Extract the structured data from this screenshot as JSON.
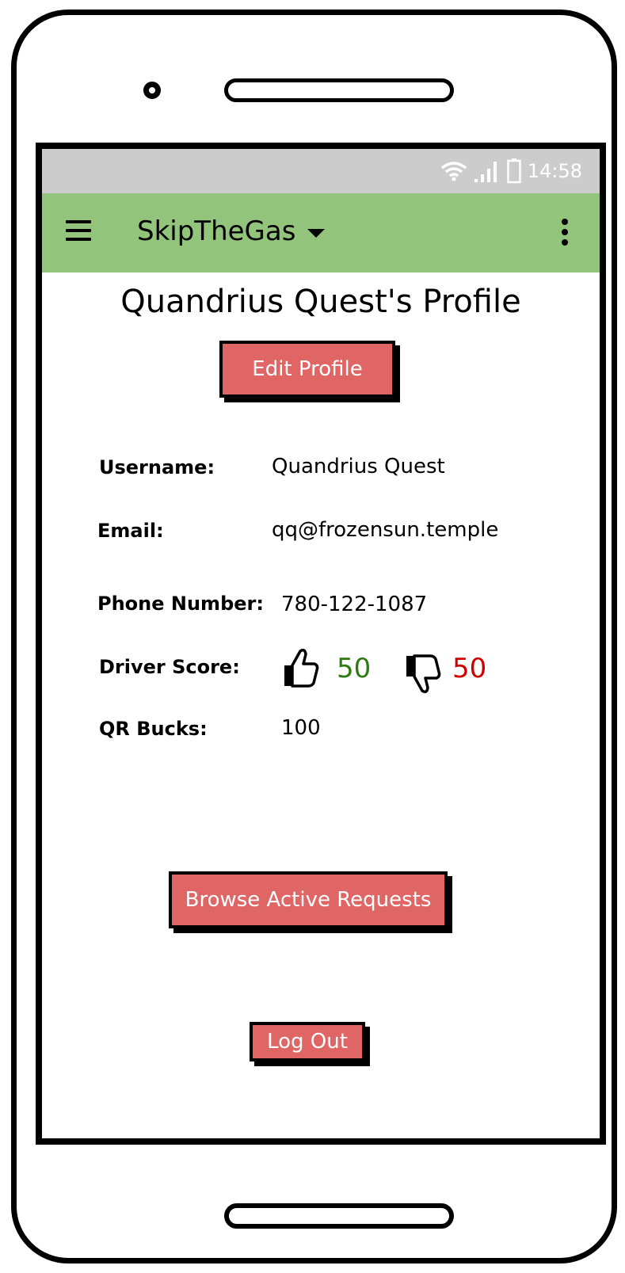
{
  "status_bar": {
    "time": "14:58",
    "icons": [
      "wifi-icon",
      "signal-icon",
      "battery-icon"
    ]
  },
  "app_bar": {
    "title": "SkipTheGas",
    "menu_icon": "hamburger-icon",
    "overflow_icon": "more-vert-icon"
  },
  "profile": {
    "title": "Quandrius Quest's Profile",
    "edit_button": "Edit Profile",
    "fields": {
      "username": {
        "label": "Username:",
        "value": "Quandrius Quest"
      },
      "email": {
        "label": "Email:",
        "value": "qq@frozensun.temple"
      },
      "phone": {
        "label": "Phone Number:",
        "value": "780-122-1087"
      },
      "driver_score": {
        "label": "Driver Score:",
        "thumbs_up": "50",
        "thumbs_down": "50"
      },
      "qr_bucks": {
        "label": "QR Bucks:",
        "value": "100"
      }
    },
    "browse_button": "Browse Active Requests",
    "logout_button": "Log Out"
  },
  "colors": {
    "app_bar": "#92c47c",
    "status_bar": "#cccccc",
    "button": "#e06666",
    "thumbs_up_score": "#2d7a12",
    "thumbs_down_score": "#cc0000"
  }
}
